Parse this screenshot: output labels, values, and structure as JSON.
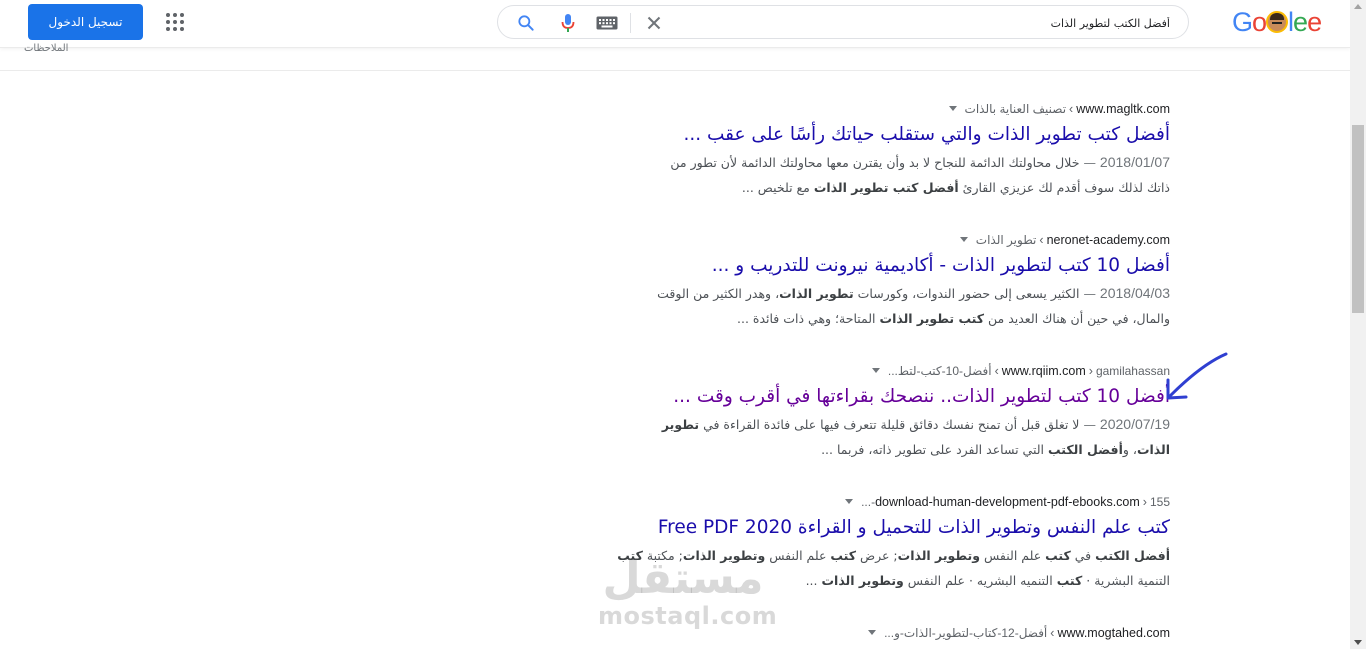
{
  "header": {
    "signin_label": "تسجيل الدخول",
    "search_query": "أفضل الكتب لتطوير الذات",
    "logo_text": [
      "G",
      "o",
      "g",
      "l",
      "e"
    ],
    "accent_color": "#1a73e8",
    "icons": [
      "apps-grid-icon",
      "search-icon",
      "mic-icon",
      "keyboard-icon",
      "clear-icon"
    ]
  },
  "subbar": {
    "notes_label": "الملاحظات"
  },
  "results": [
    {
      "domain": "www.magltk.com",
      "sep": "›",
      "path": "تصنيف العناية بالذات",
      "title": "أفضل كتب تطوير الذات والتي ستقلب حياتك رأسًا على عقب ...",
      "date": "2018/01/07",
      "dash": "—",
      "line1": "خلال محاولتك الدائمة للنجاح لا بد وأن يقترن معها محاولتك الدائمة لأن تطور من",
      "line2_a": "ذاتك لذلك سوف أقدم لك عزيزي القارئ ",
      "line2_b": "أفضل كتب تطوير الذات",
      "line2_c": " مع تلخيص ..."
    },
    {
      "domain": "neronet-academy.com",
      "sep": "›",
      "path": "تطوير الذات",
      "title": "أفضل 10 كتب لتطوير الذات - أكاديمية نيرونت للتدريب و ...",
      "date": "2018/04/03",
      "dash": "—",
      "line1_a": "الكثير يسعى إلى حضور الندوات، وكورسات ",
      "line1_b": "تطوير الذات",
      "line1_c": "، وهدر الكثير من الوقت",
      "line2_a": "والمال، في حين أن هناك العديد من ",
      "line2_b": "كتب تطوير الذات",
      "line2_c": " المتاحة؛ وهي ذات فائدة ..."
    },
    {
      "domain": "www.rqiim.com",
      "sep": "›",
      "path": "gamilahassan",
      "path2": "أفضل-10-كتب-لتط...",
      "title": "أفضل 10 كتب لتطوير الذات.. ننصحك بقراءتها في أقرب وقت ...",
      "date": "2020/07/19",
      "dash": "—",
      "line1_a": "لا تغلق قبل أن تمنح نفسك دقائق قليلة تتعرف فيها على فائدة القراءة في ",
      "line1_b": "تطوير",
      "line2_a": "الذات",
      "line2_b": "، و",
      "line2_c": "أفضل الكتب",
      "line2_d": " التي تساعد الفرد على تطوير ذاته، فربما ..."
    },
    {
      "domain": "download-human-development-pdf-ebooks.com",
      "sep": "›",
      "path": "155-...",
      "title": "كتب علم النفس وتطوير الذات للتحميل و القراءة Free PDF 2020",
      "line1_a": "أفضل الكتب",
      "line1_b": " في ",
      "line1_c": "كتب",
      "line1_d": " علم النفس ",
      "line1_e": "وتطوير الذات",
      "line1_f": "; عرض ",
      "line1_g": "كتب",
      "line1_h": " علم النفس ",
      "line1_i": "وتطوير الذات",
      "line1_j": "; مكتبة ",
      "line1_k": "كتب",
      "line2_a": "التنمية البشرية · ",
      "line2_b": "كتب",
      "line2_c": " التنميه البشريه · علم النفس ",
      "line2_d": "وتطوير الذات",
      "line2_e": " ..."
    },
    {
      "domain": "www.mogtahed.com",
      "sep": "›",
      "path": "أفضل-12-كتاب-لتطوير-الذات-و..."
    }
  ],
  "watermark": {
    "arabic": "مستقل",
    "latin": "mostaql.com"
  },
  "colors": {
    "link": "#1a0dab",
    "visited": "#660099",
    "annotation": "#2f3fd1"
  }
}
